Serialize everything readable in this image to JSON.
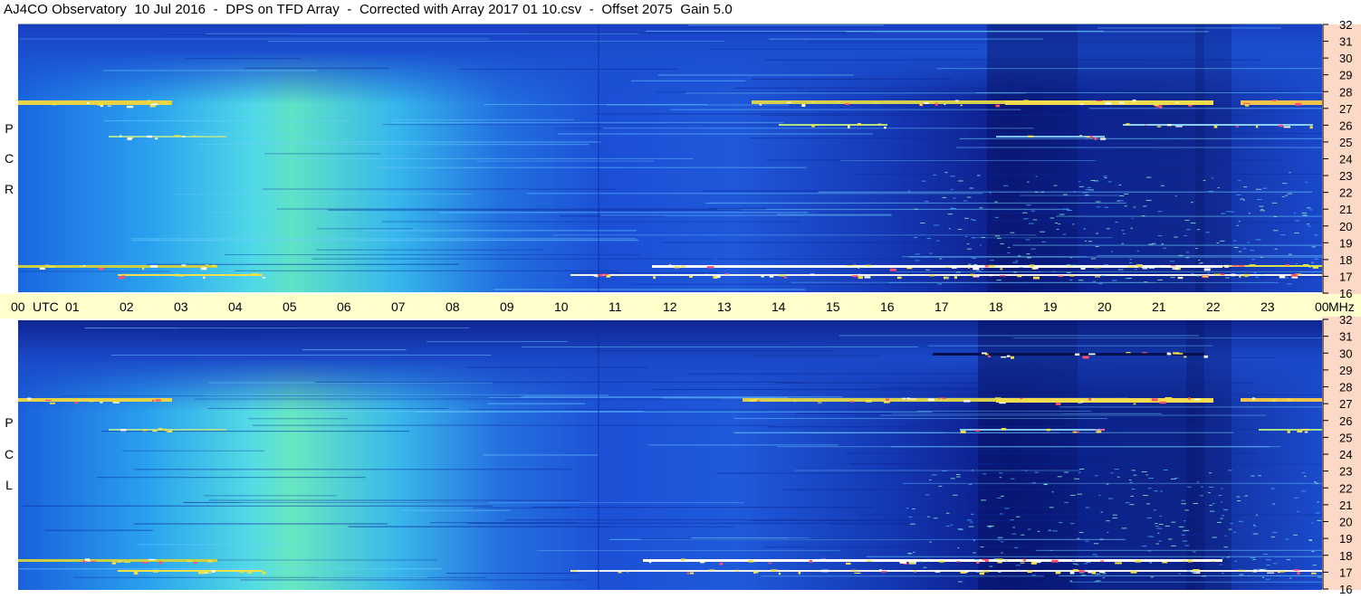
{
  "title": "AJ4CO Observatory  10 Jul 2016  -  DPS on TFD Array  -  Corrected with Array 2017 01 10.csv  -  Offset 2075  Gain 5.0",
  "panels": [
    {
      "id": "rcp",
      "label_letters": [
        "P",
        "C",
        "R"
      ]
    },
    {
      "id": "lcp",
      "label_letters": [
        "P",
        "C",
        "L"
      ]
    }
  ],
  "time_axis": {
    "unit_label": "UTC",
    "mhz_label": "MHz",
    "ticks": [
      "00",
      "01",
      "02",
      "03",
      "04",
      "05",
      "06",
      "07",
      "08",
      "09",
      "10",
      "11",
      "12",
      "13",
      "14",
      "15",
      "16",
      "17",
      "18",
      "19",
      "20",
      "21",
      "22",
      "23",
      "00"
    ]
  },
  "freq_axis": {
    "ticks": [
      "32",
      "31",
      "30",
      "29",
      "28",
      "27",
      "26",
      "25",
      "24",
      "23",
      "22",
      "21",
      "20",
      "19",
      "18",
      "17",
      "16"
    ]
  },
  "colors": {
    "time_band": "#ffffcc",
    "freq_band": "#fbd9c6",
    "bright": "#f2e04a",
    "hot": "#ff4f6e"
  },
  "chart_data": [
    {
      "type": "heatmap",
      "panel": "RCP",
      "x_range_utc_hours": [
        0,
        24
      ],
      "y_range_mhz": [
        16,
        32
      ],
      "notes_bright_bands_mhz": [
        27.2,
        17.6,
        16.8
      ]
    },
    {
      "type": "heatmap",
      "panel": "LCP",
      "x_range_utc_hours": [
        0,
        24
      ],
      "y_range_mhz": [
        16,
        32
      ],
      "notes_bright_bands_mhz": [
        27.0,
        17.6,
        16.8
      ]
    }
  ]
}
